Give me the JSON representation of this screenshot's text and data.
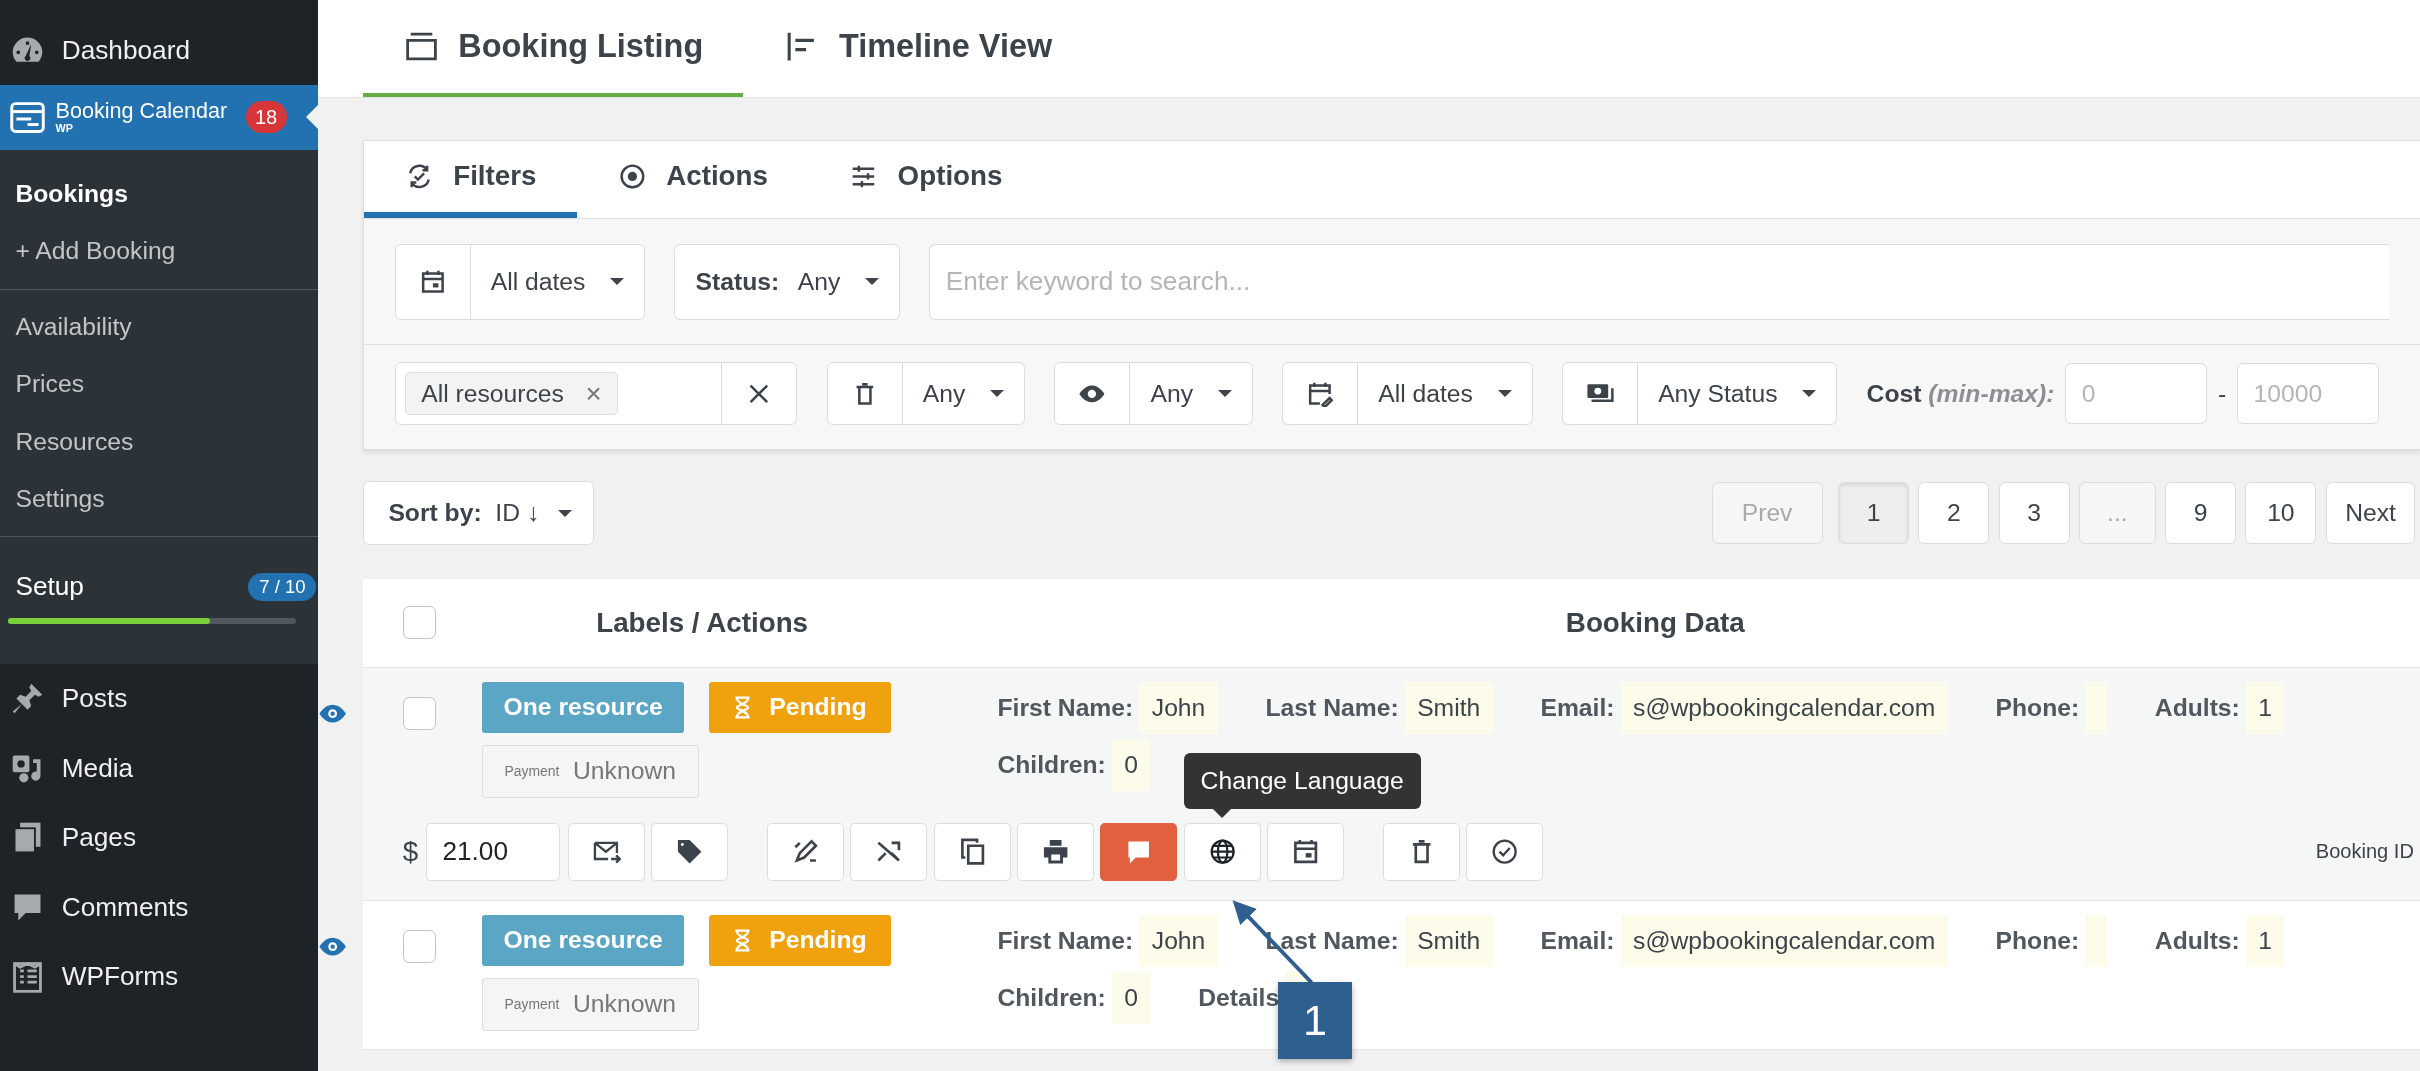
{
  "sidebar": {
    "top": [
      {
        "label": "Dashboard",
        "selected": false
      }
    ],
    "plugin": {
      "title": "Booking Calendar",
      "subtitle": "WP",
      "badge": "18",
      "selected": true
    },
    "groups": [
      {
        "items": [
          {
            "label": "Bookings",
            "selected": true
          },
          {
            "label": "+ Add Booking",
            "selected": false
          }
        ]
      },
      {
        "items": [
          {
            "label": "Availability",
            "selected": false
          },
          {
            "label": "Prices",
            "selected": false
          },
          {
            "label": "Resources",
            "selected": false
          },
          {
            "label": "Settings",
            "selected": false
          }
        ]
      }
    ],
    "setup": {
      "label": "Setup",
      "badge": "7 / 10",
      "level": 0.7
    },
    "items": [
      {
        "label": "Posts"
      },
      {
        "label": "Media"
      },
      {
        "label": "Pages"
      },
      {
        "label": "Comments"
      },
      {
        "label": "WPForms"
      }
    ]
  },
  "view_tabs": [
    {
      "label": "Booking Listing",
      "selected": true
    },
    {
      "label": "Timeline View",
      "selected": false
    }
  ],
  "filter_tabs": [
    {
      "label": "Filters",
      "selected": true
    },
    {
      "label": "Actions",
      "selected": false
    },
    {
      "label": "Options",
      "selected": false
    }
  ],
  "filters": {
    "dates": "All dates",
    "status_label": "Status:",
    "status": "Any",
    "search_placeholder": "Enter keyword to search...",
    "resource_tag": "All resources",
    "resource_tag_remove": "×",
    "trash": "Any",
    "visibility": "Any",
    "modified": "All dates",
    "payment_status": "Any Status",
    "cost_label": "Cost",
    "cost_hint": "(min-max):",
    "cost_min_placeholder": "0",
    "cost_separator": "-",
    "cost_max_placeholder": "10000"
  },
  "sort": {
    "label": "Sort by:",
    "value": "ID ↓"
  },
  "pagination": [
    {
      "label": "Prev",
      "selected": false,
      "disabled": true
    },
    {
      "label": "1",
      "selected": true,
      "disabled": false
    },
    {
      "label": "2",
      "selected": false,
      "disabled": false
    },
    {
      "label": "3",
      "selected": false,
      "disabled": false
    },
    {
      "label": "...",
      "selected": false,
      "disabled": true
    },
    {
      "label": "9",
      "selected": false,
      "disabled": false
    },
    {
      "label": "10",
      "selected": false,
      "disabled": false
    },
    {
      "label": "Next",
      "selected": false,
      "disabled": false
    }
  ],
  "table": {
    "columns": [
      "Labels / Actions",
      "Booking Data"
    ],
    "all_checked": false,
    "rows": [
      {
        "checked": false,
        "resource": "One resource",
        "status": "Pending",
        "payment_label": "Payment",
        "payment": "Unknown",
        "fields": [
          {
            "label": "First Name:",
            "value": "John"
          },
          {
            "label": "Last Name:",
            "value": "Smith"
          },
          {
            "label": "Email:",
            "value": "s@wpbookingcalendar.com"
          },
          {
            "label": "Phone:"
          },
          {
            "label": "Adults:",
            "value": "1"
          },
          {
            "label": "Children:",
            "value": "0"
          }
        ],
        "actions": {
          "currency": "$",
          "cost": "21.00",
          "booking_id_label": "Booking ID",
          "groups": [
            {
              "buttons": [
                {
                  "kind": "email",
                  "highlighted": false
                },
                {
                  "kind": "tag",
                  "highlighted": false
                }
              ]
            },
            {
              "buttons": [
                {
                  "kind": "edit",
                  "highlighted": false
                },
                {
                  "kind": "shuffle",
                  "highlighted": false
                },
                {
                  "kind": "copy",
                  "highlighted": false
                },
                {
                  "kind": "print",
                  "highlighted": false
                },
                {
                  "kind": "notes",
                  "highlighted": true
                },
                {
                  "kind": "language",
                  "highlighted": false,
                  "tooltip": "Change Language"
                },
                {
                  "kind": "calendar",
                  "highlighted": false
                }
              ]
            },
            {
              "buttons": [
                {
                  "kind": "trash",
                  "highlighted": false
                },
                {
                  "kind": "approve",
                  "highlighted": false
                }
              ]
            }
          ]
        }
      },
      {
        "checked": false,
        "resource": "One resource",
        "status": "Pending",
        "payment_label": "Payment",
        "payment": "Unknown",
        "fields": [
          {
            "label": "First Name:",
            "value": "John"
          },
          {
            "label": "Last Name:",
            "value": "Smith"
          },
          {
            "label": "Email:",
            "value": "s@wpbookingcalendar.com"
          },
          {
            "label": "Phone:"
          },
          {
            "label": "Adults:",
            "value": "1"
          },
          {
            "label": "Children:",
            "value": "0"
          },
          {
            "label": "Details"
          }
        ]
      }
    ]
  },
  "annotation": {
    "number": "1"
  }
}
